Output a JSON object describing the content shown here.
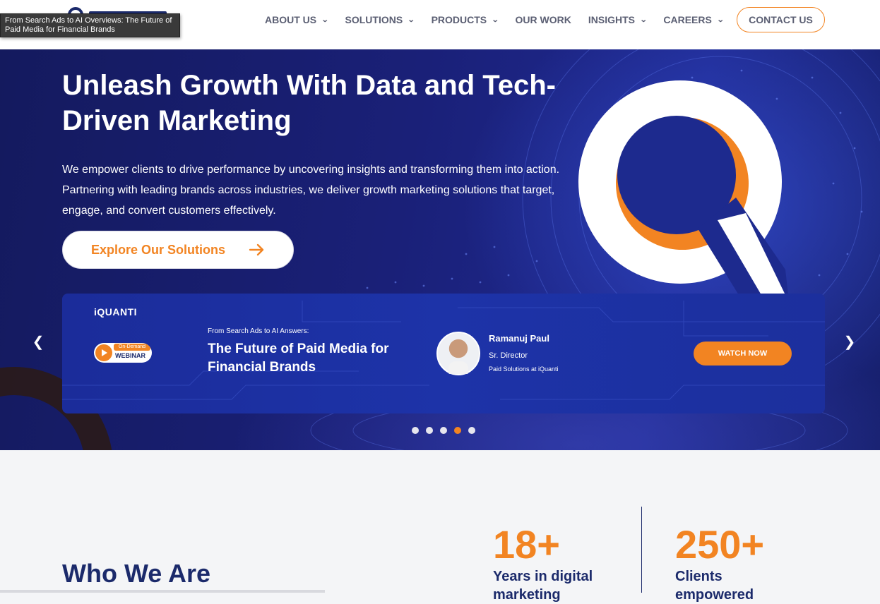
{
  "tooltip": {
    "text": "From Search Ads to AI Overviews: The Future of Paid Media for Financial Brands"
  },
  "nav": {
    "items": [
      {
        "label": "ABOUT US",
        "has_dropdown": true
      },
      {
        "label": "SOLUTIONS",
        "has_dropdown": true
      },
      {
        "label": "PRODUCTS",
        "has_dropdown": true
      },
      {
        "label": "OUR WORK",
        "has_dropdown": false
      },
      {
        "label": "INSIGHTS",
        "has_dropdown": true
      },
      {
        "label": "CAREERS",
        "has_dropdown": true
      }
    ],
    "contact_label": "CONTACT US"
  },
  "hero": {
    "title": "Unleash Growth With Data and Tech-Driven Marketing",
    "description": "We empower clients to drive performance by uncovering insights and transforming them into action. Partnering with leading brands across industries, we deliver growth marketing solutions that target, engage, and convert customers effectively.",
    "cta_label": "Explore Our Solutions"
  },
  "banner": {
    "brand": "iQUANTI",
    "badge_top": "On-Demand",
    "badge_label": "WEBINAR",
    "subtitle": "From Search Ads to AI Answers:",
    "title": "The Future of Paid Media for Financial Brands",
    "speaker_name": "Ramanuj Paul",
    "speaker_role": "Sr. Director",
    "speaker_org": "Paid Solutions at iQuanti",
    "watch_label": "WATCH NOW"
  },
  "carousel": {
    "slide_count": 5,
    "active_index": 3
  },
  "about": {
    "title": "Who We Are",
    "stats": [
      {
        "number": "18+",
        "label": "Years in digital marketing"
      },
      {
        "number": "250+",
        "label": "Clients empowered"
      }
    ]
  },
  "colors": {
    "accent": "#f28422",
    "navy": "#1b2a6b",
    "hero_bg": "#1a2078"
  },
  "icons": {
    "menu_chevron": "chevron-down-icon",
    "cta_arrow": "arrow-right-icon",
    "carousel_prev": "chevron-left-icon",
    "carousel_next": "chevron-right-icon"
  }
}
